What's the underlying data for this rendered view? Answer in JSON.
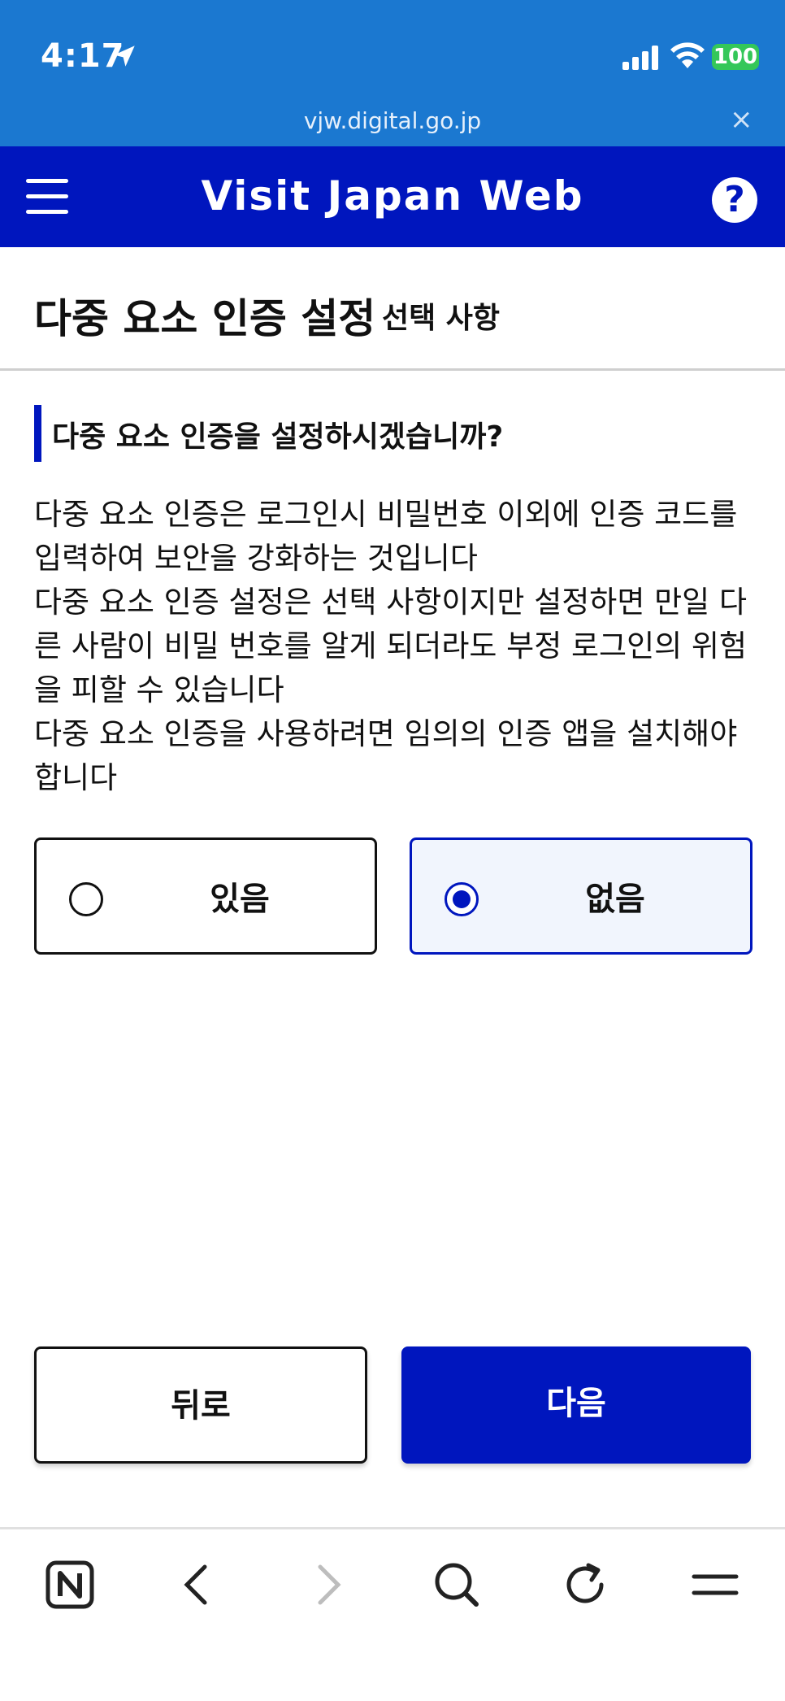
{
  "status_bar": {
    "time": "4:17",
    "battery": "100",
    "battery_color": "#34c759"
  },
  "browser": {
    "url": "vjw.digital.go.jp",
    "close_glyph": "×"
  },
  "header": {
    "title": "Visit Japan Web",
    "help_glyph": "?",
    "bg_color": "#0016be"
  },
  "page": {
    "title": "다중 요소 인증 설정",
    "optional_label": "선택 사항"
  },
  "section": {
    "heading": "다중 요소 인증을 설정하시겠습니까?",
    "description": [
      "다중 요소 인증은 로그인시 비밀번호 이외에 인증 코드를 입력하여 보안을 강화하는 것입니다",
      "다중 요소 인증 설정은 선택 사항이지만 설정하면 만일 다른 사람이 비밀 번호를 알게 되더라도 부정 로그인의 위험을 피할 수 있습니다",
      "다중 요소 인증을 사용하려면 임의의 인증 앱을 설치해야 합니다"
    ]
  },
  "options": {
    "yes_label": "있음",
    "no_label": "없음",
    "selected": "없음"
  },
  "actions": {
    "back_label": "뒤로",
    "next_label": "다음"
  },
  "toolbar": {
    "icons": [
      "naver-n-icon",
      "back-arrow-icon",
      "forward-arrow-icon",
      "search-icon",
      "reload-icon",
      "menu-icon"
    ]
  }
}
